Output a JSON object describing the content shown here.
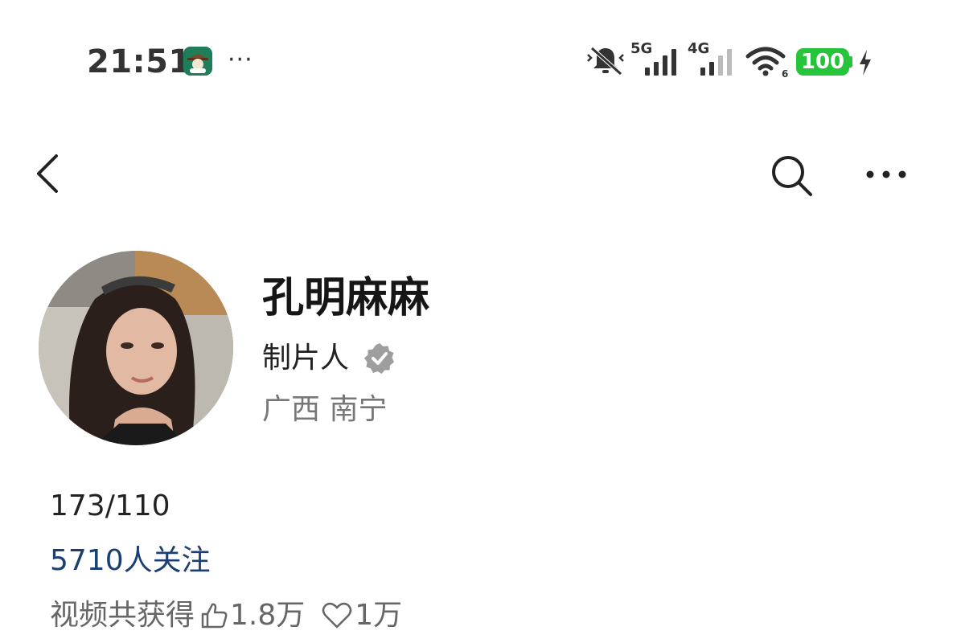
{
  "status_bar": {
    "time": "21:51",
    "more_dots": "···",
    "net1": "5G",
    "net2": "4G",
    "battery": "100",
    "icons": [
      "app-icon",
      "bell-mute-icon",
      "signal-icon",
      "signal-icon",
      "wifi-icon",
      "battery-icon",
      "charging-icon"
    ]
  },
  "nav": {
    "icons": [
      "back-icon",
      "search-icon",
      "more-icon"
    ]
  },
  "profile": {
    "name": "孔明麻麻",
    "title": "制片人",
    "location": "广西 南宁",
    "bio": "173/110",
    "followers": "5710人关注",
    "stats_label": "视频共获得",
    "likes": "1.8万",
    "favorites": "1万",
    "icons": [
      "verified-icon",
      "thumb-up-icon",
      "heart-icon"
    ]
  },
  "colors": {
    "battery": "#25c43a",
    "followers": "#1c3f73",
    "verified": "#9e9e9e"
  }
}
